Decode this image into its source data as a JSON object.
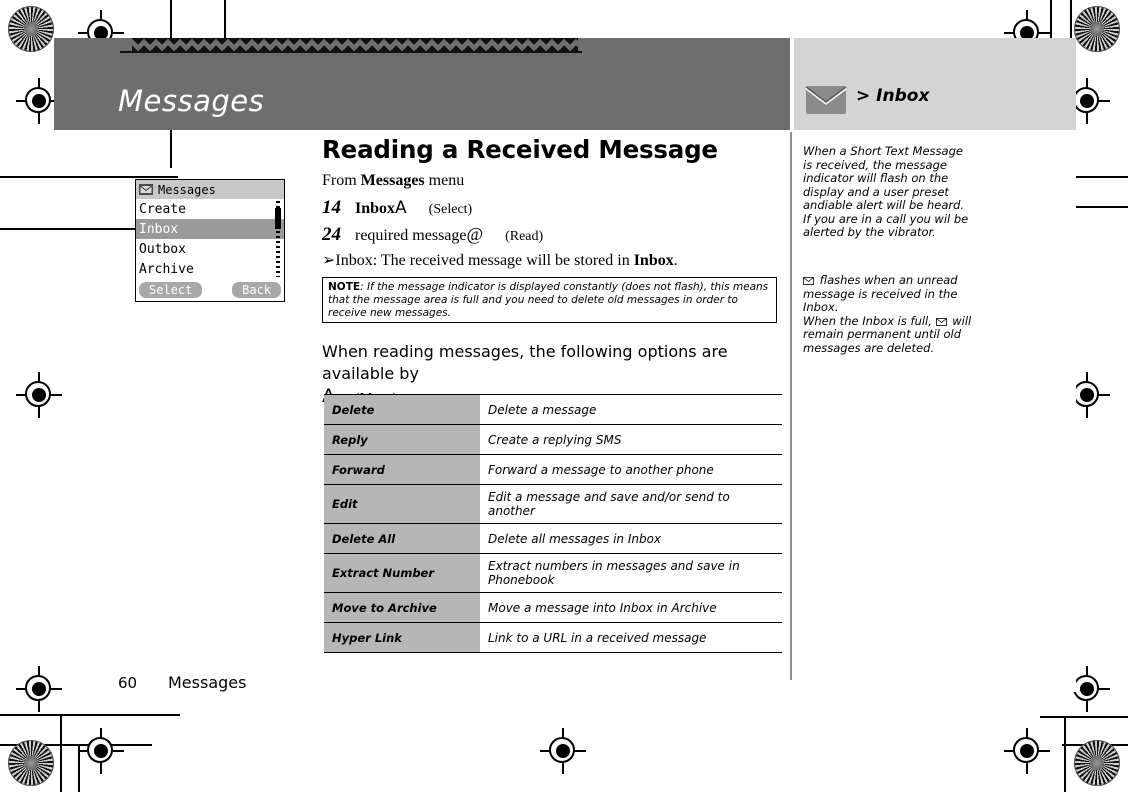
{
  "header": {
    "title": "Messages",
    "tab_label": "> Inbox",
    "tab_icon": "envelope-icon",
    "ornament": "zigzag-rule"
  },
  "main": {
    "heading": "Reading a Received Message",
    "from_prefix": "From ",
    "from_bold": "Messages",
    "from_suffix": " menu",
    "steps": [
      {
        "num": "14",
        "label": "Inbox",
        "symbol": "A",
        "action": "(Select)"
      },
      {
        "num": "24",
        "label": "required message",
        "symbol": "@",
        "action": "(Read)"
      }
    ],
    "bullet": "➢Inbox: The received message will be stored in Inbox.",
    "bullet_plain": "➢Inbox: The received message will be stored in ",
    "bullet_bold": "Inbox",
    "bullet_end": ".",
    "note_label": "NOTE",
    "note_text": ": If the message indicator is displayed constantly (does not flash), this means that the message area is full and you need to delete old messages in order to receive new messages.",
    "lead_text": "When reading messages, the following options are available by",
    "lead_symbol": "A",
    "lead_action": "(Menu)"
  },
  "options_table": {
    "rows": [
      {
        "name": "Delete",
        "description": "Delete a message"
      },
      {
        "name": "Reply",
        "description": "Create a replying SMS"
      },
      {
        "name": "Forward",
        "description": "Forward a message to another phone"
      },
      {
        "name": "Edit",
        "description": "Edit a message and save and/or send to another"
      },
      {
        "name": "Delete All",
        "description": "Delete all messages in Inbox"
      },
      {
        "name": "Extract Number",
        "description": "Extract numbers in messages and save in Phonebook"
      },
      {
        "name": "Move to Archive",
        "description": "Move a message into Inbox in Archive"
      },
      {
        "name": "Hyper Link",
        "description": "Link to a URL in a received message"
      }
    ]
  },
  "phone_mockup": {
    "title": "Messages",
    "title_icon": "envelope-icon",
    "items": [
      {
        "label": "Create",
        "selected": false
      },
      {
        "label": "Inbox",
        "selected": true
      },
      {
        "label": "Outbox",
        "selected": false
      },
      {
        "label": "Archive",
        "selected": false
      }
    ],
    "softkey_left": "Select",
    "softkey_right": "Back"
  },
  "sidebar": {
    "paragraph_1": "When a Short Text Message is received, the message indicator will flash on the display and a user preset andiable alert will be heard. If you are in a call you wil be alerted by the vibrator.",
    "paragraph_2a": " flashes when an unread message is received in the Inbox.",
    "paragraph_2b": "When the Inbox is full, ",
    "paragraph_2c": " will remain permanent until old messages are deleted.",
    "inline_icon": "envelope-icon"
  },
  "footer": {
    "page_number": "60",
    "section": "Messages"
  },
  "colors": {
    "header_bar": "#6e6e6e",
    "tab_panel": "#d4d4d4",
    "table_key_cell": "#b6b6b6",
    "phone_title_bar": "#c8c8c8",
    "phone_selected_row": "#9a9a9a",
    "phone_softkey": "#a8a8a8",
    "page_background": "#ffffff"
  }
}
